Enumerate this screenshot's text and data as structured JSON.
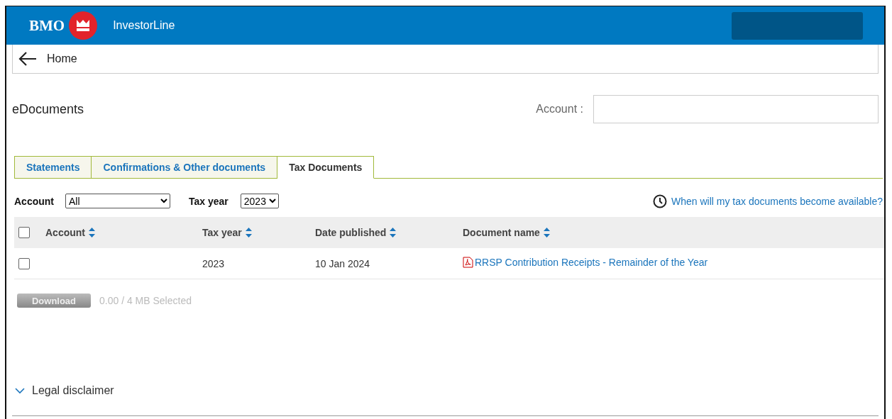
{
  "header": {
    "logo_text": "BMO",
    "product": "InvestorLine"
  },
  "nav": {
    "back_label": "Home"
  },
  "page_title": "eDocuments",
  "account_field": {
    "label": "Account :"
  },
  "tabs": [
    {
      "label": "Statements",
      "selected": false
    },
    {
      "label": "Confirmations & Other documents",
      "selected": false
    },
    {
      "label": "Tax Documents",
      "selected": true
    }
  ],
  "filters": {
    "account_label": "Account",
    "account_value": "All",
    "tax_year_label": "Tax year",
    "tax_year_value": "2023",
    "help_link": "When will my tax documents become available?"
  },
  "table": {
    "select_all_checked": false,
    "columns": [
      "Account",
      "Tax year",
      "Date published",
      "Document name"
    ],
    "rows": [
      {
        "checked": false,
        "account": "",
        "tax_year": "2023",
        "date_published": "10 Jan 2024",
        "document_name": "RRSP Contribution Receipts - Remainder of the Year"
      }
    ]
  },
  "download": {
    "label": "Download",
    "disabled": true,
    "selection": "0.00 / 4 MB Selected"
  },
  "disclaimer": {
    "label": "Legal disclaimer",
    "expanded": false
  }
}
